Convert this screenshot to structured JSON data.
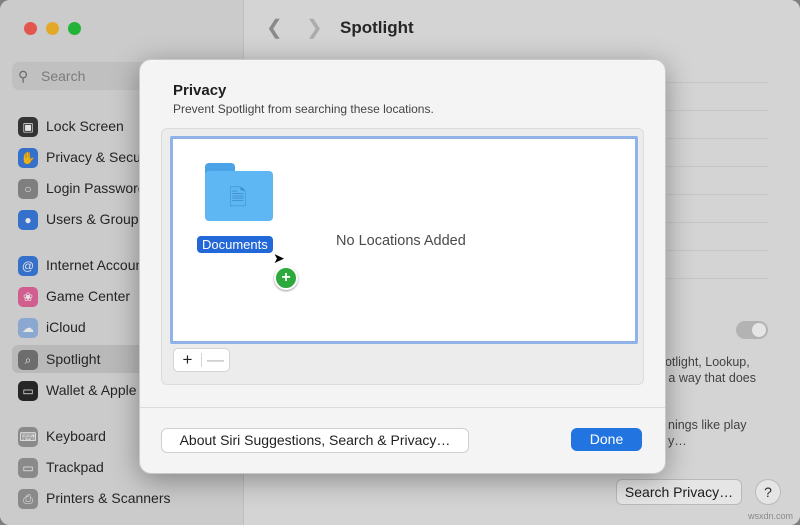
{
  "window": {
    "title": "Spotlight"
  },
  "sidebar": {
    "search_placeholder": "Search",
    "items": [
      {
        "label": "Lock Screen",
        "icon": "lock-screen-icon",
        "color": "#3a3a3a"
      },
      {
        "label": "Privacy & Security",
        "icon": "hand-icon",
        "color": "#3b7de3"
      },
      {
        "label": "Login Password",
        "icon": "key-icon",
        "color": "#8e8e8e"
      },
      {
        "label": "Users & Groups",
        "icon": "users-icon",
        "color": "#3b7de3"
      },
      {
        "label": "Internet Accounts",
        "icon": "at-icon",
        "color": "#3b7de3"
      },
      {
        "label": "Game Center",
        "icon": "game-center-icon",
        "color": "#e86aa0"
      },
      {
        "label": "iCloud",
        "icon": "cloud-icon",
        "color": "#9bbbe8"
      },
      {
        "label": "Spotlight",
        "icon": "magnifier-icon",
        "color": "#7a7a7a",
        "selected": true
      },
      {
        "label": "Wallet & Apple Pay",
        "icon": "wallet-icon",
        "color": "#2b2b2b"
      },
      {
        "label": "Keyboard",
        "icon": "keyboard-icon",
        "color": "#9a9a9a"
      },
      {
        "label": "Trackpad",
        "icon": "trackpad-icon",
        "color": "#9a9a9a"
      },
      {
        "label": "Printers & Scanners",
        "icon": "printer-icon",
        "color": "#9a9a9a"
      }
    ]
  },
  "content": {
    "text_line1": "potlight, Lookup,",
    "text_line2": "n a way that does",
    "text_line3": "nings like play",
    "text_line4": "y…",
    "search_privacy_label": "Search Privacy…",
    "help_label": "?"
  },
  "dialog": {
    "title": "Privacy",
    "subtitle": "Prevent Spotlight from searching these locations.",
    "folder_label": "Documents",
    "empty_text": "No Locations Added",
    "add_label": "+",
    "remove_label": "—",
    "about_label": "About Siri Suggestions, Search & Privacy…",
    "done_label": "Done"
  },
  "watermark": "wsxdn.com"
}
